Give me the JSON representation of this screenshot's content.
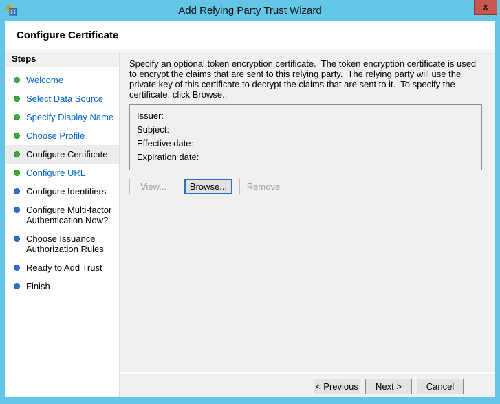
{
  "window": {
    "title": "Add Relying Party Trust Wizard",
    "close_label": "x"
  },
  "header": {
    "title": "Configure Certificate"
  },
  "sidebar": {
    "heading": "Steps",
    "items": [
      {
        "label": "Welcome",
        "status": "completed"
      },
      {
        "label": "Select Data Source",
        "status": "completed"
      },
      {
        "label": "Specify Display Name",
        "status": "completed"
      },
      {
        "label": "Choose Profile",
        "status": "completed"
      },
      {
        "label": "Configure Certificate",
        "status": "current"
      },
      {
        "label": "Configure URL",
        "status": "completed"
      },
      {
        "label": "Configure Identifiers",
        "status": "upcoming"
      },
      {
        "label": "Configure Multi-factor Authentication Now?",
        "status": "upcoming"
      },
      {
        "label": "Choose Issuance Authorization Rules",
        "status": "upcoming"
      },
      {
        "label": "Ready to Add Trust",
        "status": "upcoming"
      },
      {
        "label": "Finish",
        "status": "upcoming"
      }
    ]
  },
  "content": {
    "description": "Specify an optional token encryption certificate.  The token encryption certificate is used to encrypt the claims that are sent to this relying party.  The relying party will use the private key of this certificate to decrypt the claims that are sent to it.  To specify the certificate, click Browse..",
    "certificate": {
      "fields": [
        {
          "label": "Issuer:",
          "value": ""
        },
        {
          "label": "Subject:",
          "value": ""
        },
        {
          "label": "Effective date:",
          "value": ""
        },
        {
          "label": "Expiration date:",
          "value": ""
        }
      ]
    },
    "buttons": {
      "view": "View...",
      "browse": "Browse...",
      "remove": "Remove"
    }
  },
  "footer": {
    "previous": "< Previous",
    "next": "Next >",
    "cancel": "Cancel"
  },
  "colors": {
    "titlebar_blue": "#63c6e7",
    "close_red": "#c7564e",
    "link_blue": "#0066cc",
    "dot_completed_green": "#35b135",
    "dot_upcoming_blue": "#2d6fd4",
    "content_gray": "#f0f0f0",
    "focus_border_blue": "#2a6fbe"
  }
}
